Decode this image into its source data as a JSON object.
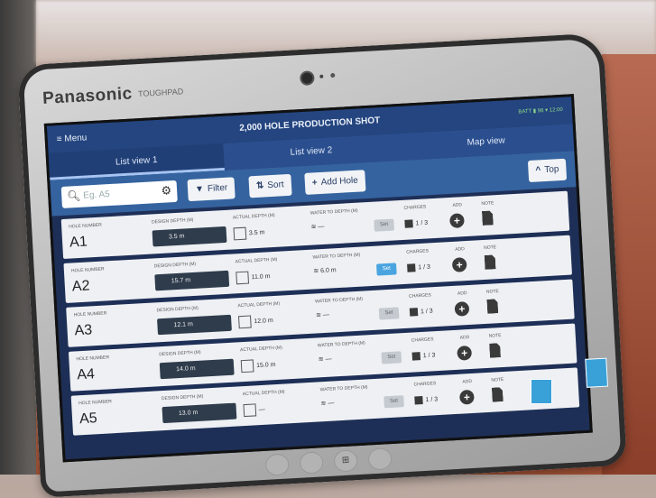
{
  "device": {
    "brand": "Panasonic",
    "model": "TOUGHPAD"
  },
  "app": {
    "menu_label": "≡ Menu",
    "title": "2,000 HOLE PRODUCTION SHOT",
    "status_text": "BATT ▮ 98 ▾ 12:00",
    "tabs": [
      {
        "label": "List view 1",
        "active": true
      },
      {
        "label": "List view 2",
        "active": false
      },
      {
        "label": "Map view",
        "active": false
      }
    ],
    "toolbar": {
      "search_placeholder": "Eg. A5",
      "filter_label": "Filter",
      "sort_label": "Sort",
      "add_hole_label": "Add Hole",
      "top_label": "Top"
    },
    "columns": {
      "hole_number": "HOLE NUMBER",
      "design_depth": "DESIGN DEPTH (m)",
      "actual_depth": "ACTUAL DEPTH (m)",
      "water_depth": "WATER TO DEPTH (m)",
      "charges": "CHARGES",
      "add": "ADD",
      "note": "NOTE"
    },
    "rows": [
      {
        "hole": "A1",
        "design": "3.5 m",
        "actual": "3.5 m",
        "water": "—",
        "set": "Set",
        "set_active": false,
        "charges": "1 / 3"
      },
      {
        "hole": "A2",
        "design": "15.7 m",
        "actual": "11.0 m",
        "water": "6.0 m",
        "set": "Set",
        "set_active": true,
        "charges": "1 / 3"
      },
      {
        "hole": "A3",
        "design": "12.1 m",
        "actual": "12.0 m",
        "water": "—",
        "set": "Set",
        "set_active": false,
        "charges": "1 / 3"
      },
      {
        "hole": "A4",
        "design": "14.0 m",
        "actual": "15.0 m",
        "water": "—",
        "set": "Set",
        "set_active": false,
        "charges": "1 / 3"
      },
      {
        "hole": "A5",
        "design": "13.0 m",
        "actual": "—",
        "water": "—",
        "set": "Set",
        "set_active": false,
        "charges": "1 / 3"
      }
    ]
  }
}
